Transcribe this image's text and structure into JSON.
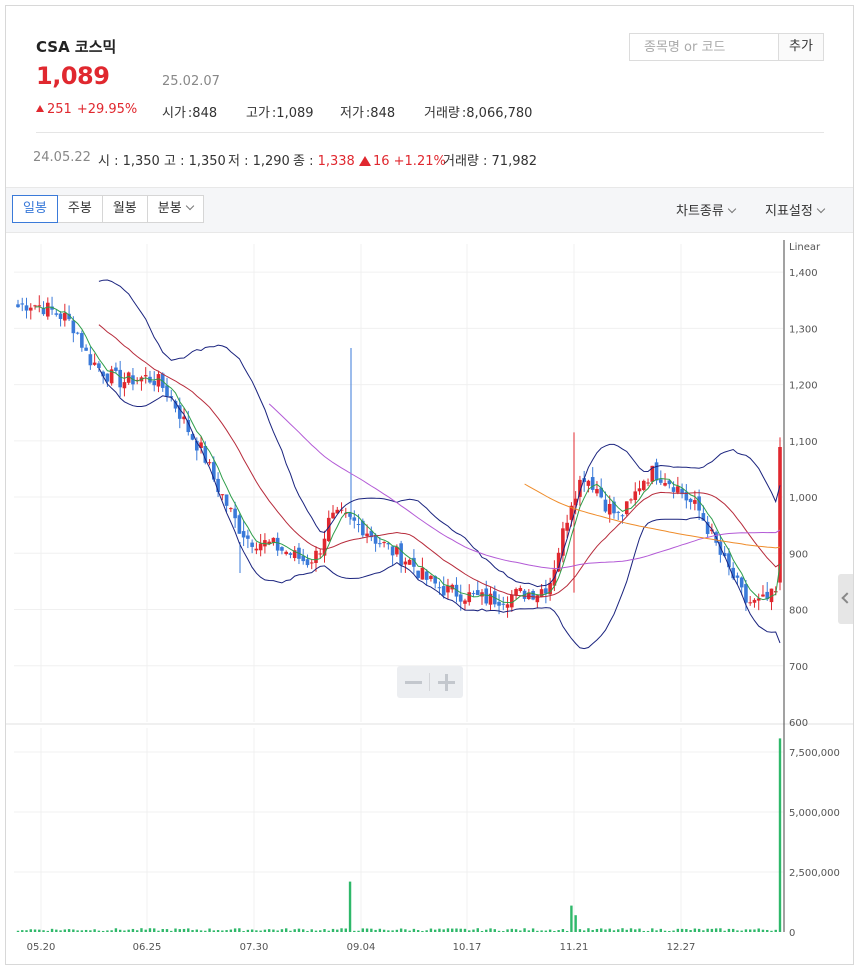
{
  "stock": {
    "name": "CSA 코스믹",
    "price": "1,089",
    "date": "25.02.07",
    "change": "251",
    "change_pct": "+29.95%",
    "open_label": "시가",
    "open": ":848",
    "high_label": "고가",
    "high": ":1,089",
    "low_label": "저가",
    "low": ":848",
    "volume_label": "거래량",
    "volume": ":8,066,780"
  },
  "search": {
    "placeholder": "종목명 or 코드",
    "value": "",
    "button": "추가"
  },
  "daybar": {
    "date": "24.05.22",
    "open": "시 : 1,350",
    "high": "고 : 1,350",
    "low": "저 : 1,290",
    "close_label": "종 : ",
    "close": "1,338",
    "change": "16 +1.21%",
    "volume": "거래량 : 71,982"
  },
  "toolbar": {
    "tabs": [
      "일봉",
      "주봉",
      "월봉",
      "분봉"
    ],
    "active_tab": "일봉",
    "chart_type_label": "차트종류",
    "indicator_label": "지표설정"
  },
  "colors": {
    "up": "#e0282f",
    "down": "#3a7ad9",
    "volume": "#2fb86a",
    "bollinger": "#1a237e",
    "ma5": "#2e9e4a",
    "ma20": "#b72b3b",
    "ma60": "#b35ad6",
    "ma120": "#ef8c2a"
  },
  "chart_data": {
    "type": "candlestick",
    "scale_label": "Linear",
    "ylim": [
      600,
      1450
    ],
    "y_ticks": [
      "1,400",
      "1,300",
      "1,200",
      "1,100",
      "1,000",
      "900",
      "800",
      "700",
      "600"
    ],
    "volume_ylim": [
      0,
      8500000
    ],
    "volume_ticks": [
      "7,500,000",
      "5,000,000",
      "2,500,000",
      "0"
    ],
    "x_labels": [
      "05.20",
      "06.25",
      "07.30",
      "09.04",
      "10.17",
      "11.21",
      "12.27"
    ],
    "close_path": [
      1338,
      1345,
      1340,
      1330,
      1320,
      1300,
      1250,
      1230,
      1215,
      1205,
      1210,
      1212,
      1208,
      1185,
      1150,
      1110,
      1080,
      1030,
      990,
      950,
      925,
      920,
      915,
      905,
      895,
      885,
      900,
      960,
      965,
      955,
      945,
      925,
      910,
      895,
      885,
      860,
      845,
      835,
      830,
      825,
      820,
      818,
      822,
      826,
      830,
      832,
      845,
      920,
      1000,
      1040,
      1020,
      985,
      965,
      985,
      1030,
      1045,
      1035,
      1020,
      995,
      975,
      935,
      890,
      855,
      815,
      810,
      818,
      835,
      1089
    ],
    "period_high": "1,350",
    "period_low": "768",
    "last_close": "1,089",
    "last_volume": "8,066,780",
    "spike_volume": "2,100,000",
    "indicators": [
      "Bollinger Bands",
      "MA5",
      "MA20",
      "MA60",
      "MA120"
    ]
  }
}
